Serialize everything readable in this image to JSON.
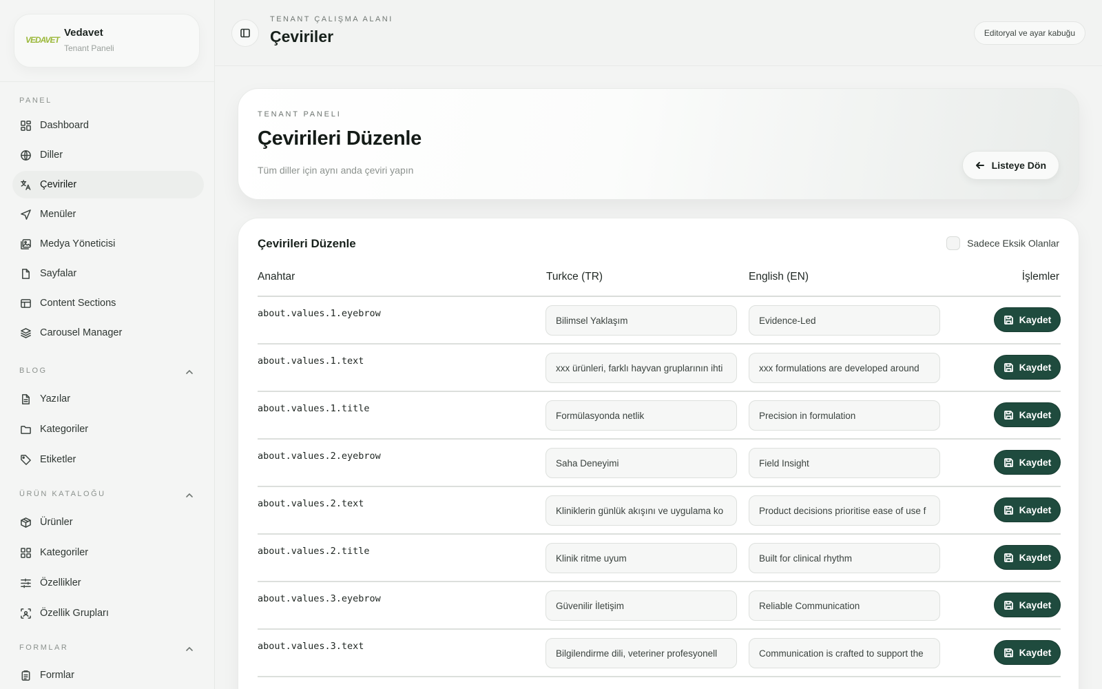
{
  "brand": {
    "logo_text": "VEDAVET",
    "name": "Vedavet",
    "subtitle": "Tenant Paneli"
  },
  "sidebar": {
    "sections": [
      {
        "label": "PANEL",
        "items": [
          {
            "label": "Dashboard",
            "icon": "dashboard-icon"
          },
          {
            "label": "Diller",
            "icon": "globe-icon"
          },
          {
            "label": "Çeviriler",
            "icon": "translate-icon",
            "active": true
          },
          {
            "label": "Menüler",
            "icon": "navigation-icon"
          },
          {
            "label": "Medya Yöneticisi",
            "icon": "images-icon"
          },
          {
            "label": "Sayfalar",
            "icon": "file-icon"
          },
          {
            "label": "Content Sections",
            "icon": "layout-icon"
          },
          {
            "label": "Carousel Manager",
            "icon": "layers-icon"
          }
        ]
      },
      {
        "label": "BLOG",
        "items": [
          {
            "label": "Yazılar",
            "icon": "document-text-icon"
          },
          {
            "label": "Kategoriler",
            "icon": "folder-icon"
          },
          {
            "label": "Etiketler",
            "icon": "tag-icon"
          }
        ]
      },
      {
        "label": "ÜRÜN KATALOĞU",
        "items": [
          {
            "label": "Ürünler",
            "icon": "package-icon"
          },
          {
            "label": "Kategoriler",
            "icon": "grid-icon"
          },
          {
            "label": "Özellikler",
            "icon": "sliders-icon"
          },
          {
            "label": "Özellik Grupları",
            "icon": "group-scan-icon"
          }
        ]
      },
      {
        "label": "FORMLAR",
        "items": [
          {
            "label": "Formlar",
            "icon": "clipboard-icon"
          }
        ]
      }
    ]
  },
  "header": {
    "eyebrow": "TENANT ÇALIŞMA ALANI",
    "title": "Çeviriler",
    "shell_label": "Editoryal ve ayar kabuğu"
  },
  "hero": {
    "eyebrow": "TENANT PANELI",
    "title": "Çevirileri Düzenle",
    "subtitle": "Tüm diller için aynı anda çeviri yapın",
    "back_label": "Listeye Dön"
  },
  "table": {
    "title": "Çevirileri Düzenle",
    "filter_label": "Sadece Eksik Olanlar",
    "columns": {
      "key": "Anahtar",
      "tr": "Turkce (TR)",
      "en": "English (EN)",
      "actions": "İşlemler"
    },
    "save_label": "Kaydet",
    "rows": [
      {
        "key": "about.values.1.eyebrow",
        "tr": "Bilimsel Yaklaşım",
        "en": "Evidence-Led"
      },
      {
        "key": "about.values.1.text",
        "tr": "xxx ürünleri, farklı hayvan gruplarının ihti",
        "en": "xxx formulations are developed around"
      },
      {
        "key": "about.values.1.title",
        "tr": "Formülasyonda netlik",
        "en": "Precision in formulation"
      },
      {
        "key": "about.values.2.eyebrow",
        "tr": "Saha Deneyimi",
        "en": "Field Insight"
      },
      {
        "key": "about.values.2.text",
        "tr": "Kliniklerin günlük akışını ve uygulama ko",
        "en": "Product decisions prioritise ease of use f"
      },
      {
        "key": "about.values.2.title",
        "tr": "Klinik ritme uyum",
        "en": "Built for clinical rhythm"
      },
      {
        "key": "about.values.3.eyebrow",
        "tr": "Güvenilir İletişim",
        "en": "Reliable Communication"
      },
      {
        "key": "about.values.3.text",
        "tr": "Bilgilendirme dili, veteriner profesyonell",
        "en": "Communication is crafted to support the"
      }
    ]
  }
}
